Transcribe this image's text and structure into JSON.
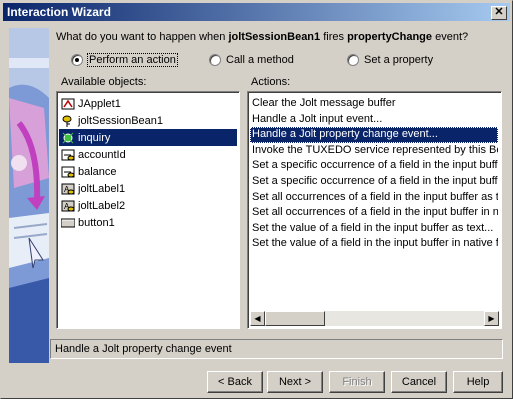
{
  "window": {
    "title": "Interaction Wizard",
    "close_glyph": "✕"
  },
  "question": {
    "prefix": "What do you want to happen when ",
    "source": "joltSessionBean1",
    "middle": " fires ",
    "event": "propertyChange",
    "suffix": " event?"
  },
  "options": [
    {
      "label": "Perform an action",
      "selected": true
    },
    {
      "label": "Call a method",
      "selected": false
    },
    {
      "label": "Set a property",
      "selected": false
    }
  ],
  "objects": {
    "header": "Available objects:",
    "items": [
      {
        "label": "JApplet1",
        "icon": "applet-icon"
      },
      {
        "label": "joltSessionBean1",
        "icon": "bean-icon"
      },
      {
        "label": "inquiry",
        "icon": "bean-icon",
        "selected": true
      },
      {
        "label": "accountId",
        "icon": "textfield-icon"
      },
      {
        "label": "balance",
        "icon": "textfield-icon"
      },
      {
        "label": "joltLabel1",
        "icon": "label-icon"
      },
      {
        "label": "joltLabel2",
        "icon": "label-icon"
      },
      {
        "label": "button1",
        "icon": "button-icon"
      }
    ]
  },
  "actions": {
    "header": "Actions:",
    "items": [
      "Clear the Jolt message buffer",
      "Handle a Jolt input event...",
      "Handle a Jolt property change event...",
      "Invoke the TUXEDO service represented by this Bean",
      "Set a specific occurrence of a field in the input buffer as",
      "Set a specific occurrence of a field in the input buffer in",
      "Set all occurrences of a field in the input buffer as text...",
      "Set all occurrences of a field in the input buffer in native",
      "Set the value of a field in the input buffer as text...",
      "Set the value of a field in the input buffer in native format"
    ],
    "selected_index": 2
  },
  "description": "Handle a Jolt property change event",
  "buttons": {
    "back": "< Back",
    "next": "Next >",
    "finish": "Finish",
    "cancel": "Cancel",
    "help": "Help"
  }
}
